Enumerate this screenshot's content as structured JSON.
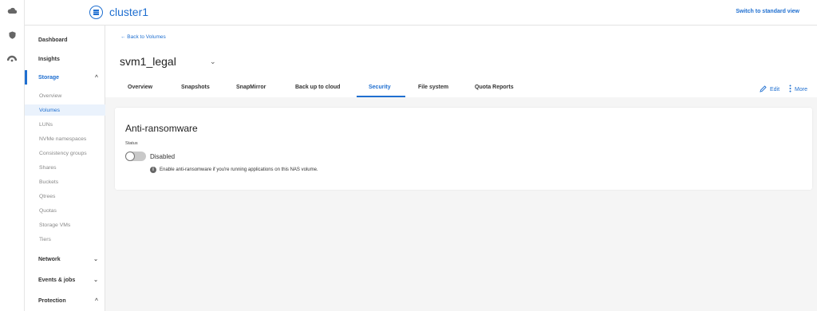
{
  "topbar": {
    "cluster_name": "cluster1",
    "switch_view": "Switch to standard view"
  },
  "rail": {
    "icons": [
      "cloud-icon",
      "shield-icon",
      "dashboard-gauge-icon"
    ]
  },
  "sidebar": {
    "dashboard": "Dashboard",
    "insights": "Insights",
    "storage": "Storage",
    "storage_items": [
      "Overview",
      "Volumes",
      "LUNs",
      "NVMe namespaces",
      "Consistency groups",
      "Shares",
      "Buckets",
      "Qtrees",
      "Quotas",
      "Storage VMs",
      "Tiers"
    ],
    "network": "Network",
    "events_jobs": "Events & jobs",
    "protection": "Protection"
  },
  "page": {
    "back_link": "← Back to Volumes",
    "volume_name": "svm1_legal"
  },
  "tabs": [
    "Overview",
    "Snapshots",
    "SnapMirror",
    "Back up to cloud",
    "Security",
    "File system",
    "Quota Reports"
  ],
  "active_tab": "Security",
  "actions": {
    "edit": "Edit",
    "more": "More"
  },
  "card": {
    "title": "Anti-ransomware",
    "status_label": "Status",
    "status_value": "Disabled",
    "info_text": "Enable anti-ransomware if you're running applications on this NAS volume."
  },
  "colors": {
    "accent": "#1f6fd0",
    "background": "#f5f5f5"
  }
}
